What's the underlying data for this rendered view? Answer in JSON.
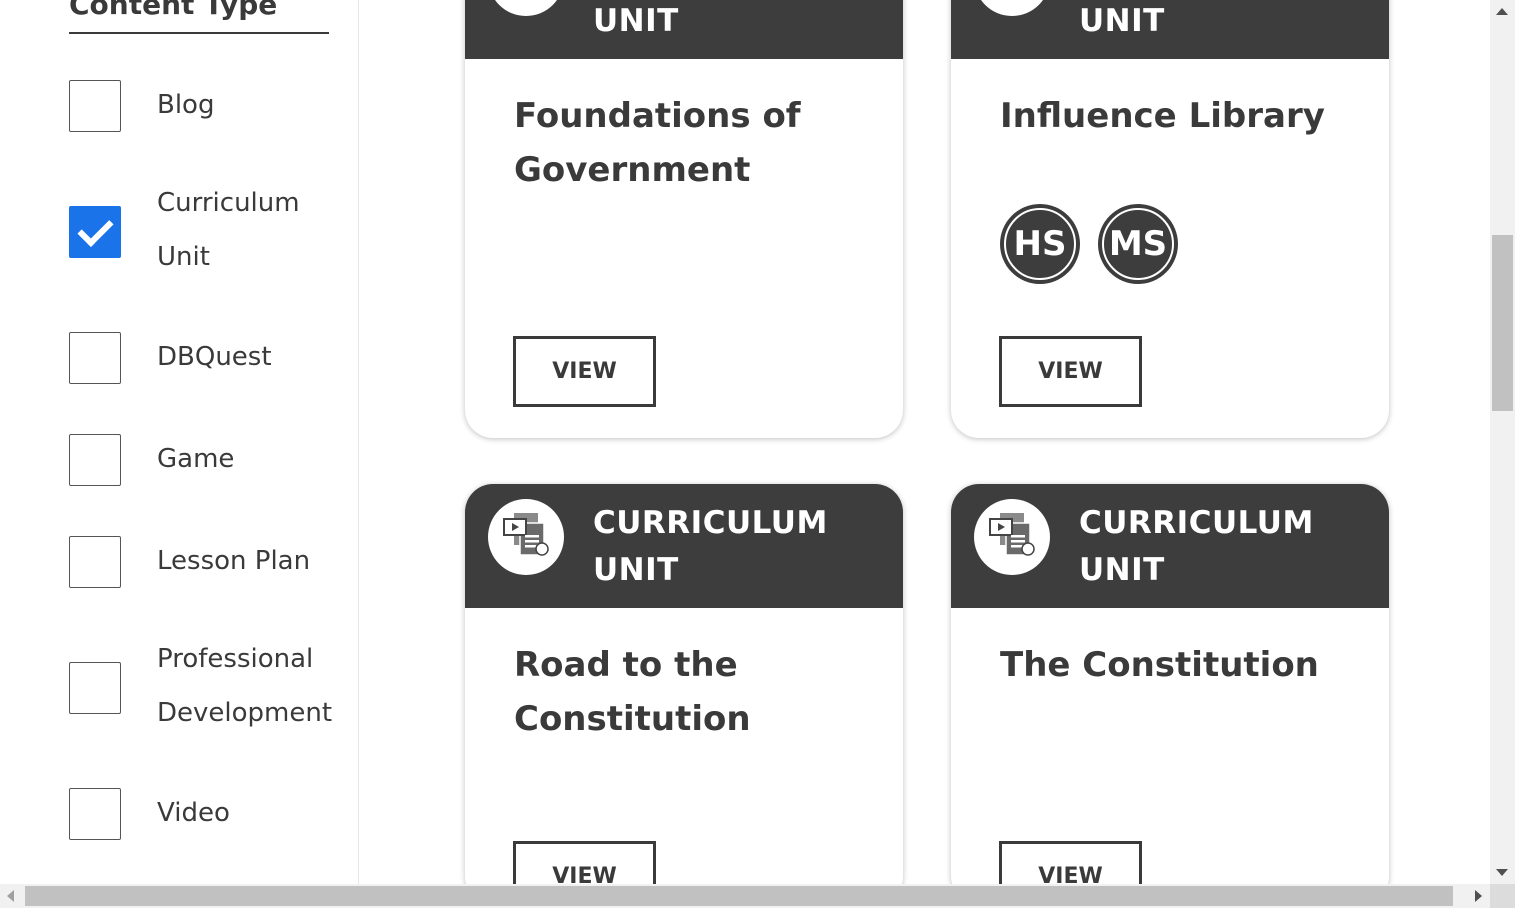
{
  "filters": {
    "title": "Content Type",
    "options": [
      {
        "label": "Blog",
        "checked": false
      },
      {
        "label": "Curriculum Unit",
        "checked": true
      },
      {
        "label": "DBQuest",
        "checked": false
      },
      {
        "label": "Game",
        "checked": false
      },
      {
        "label": "Lesson Plan",
        "checked": false
      },
      {
        "label": "Professional Development",
        "checked": false
      },
      {
        "label": "Video",
        "checked": false
      }
    ]
  },
  "cards": [
    {
      "type_label": "UNIT",
      "title": "Foundations of Government",
      "grades": [],
      "button": "VIEW",
      "icon": "curriculum-unit-icon"
    },
    {
      "type_label": "UNIT",
      "title": "Influence Library",
      "grades": [
        "HS",
        "MS"
      ],
      "button": "VIEW",
      "icon": "curriculum-unit-icon"
    },
    {
      "type_label": "CURRICULUM UNIT",
      "title": "Road to the Constitution",
      "grades": [],
      "button": "VIEW",
      "icon": "curriculum-unit-icon"
    },
    {
      "type_label": "CURRICULUM UNIT",
      "title": "The Constitution",
      "grades": [],
      "button": "VIEW",
      "icon": "curriculum-unit-icon"
    }
  ],
  "colors": {
    "header_bg": "#3d3d3d",
    "checkbox_checked": "#1a73e8",
    "text": "#3a3a3a"
  }
}
